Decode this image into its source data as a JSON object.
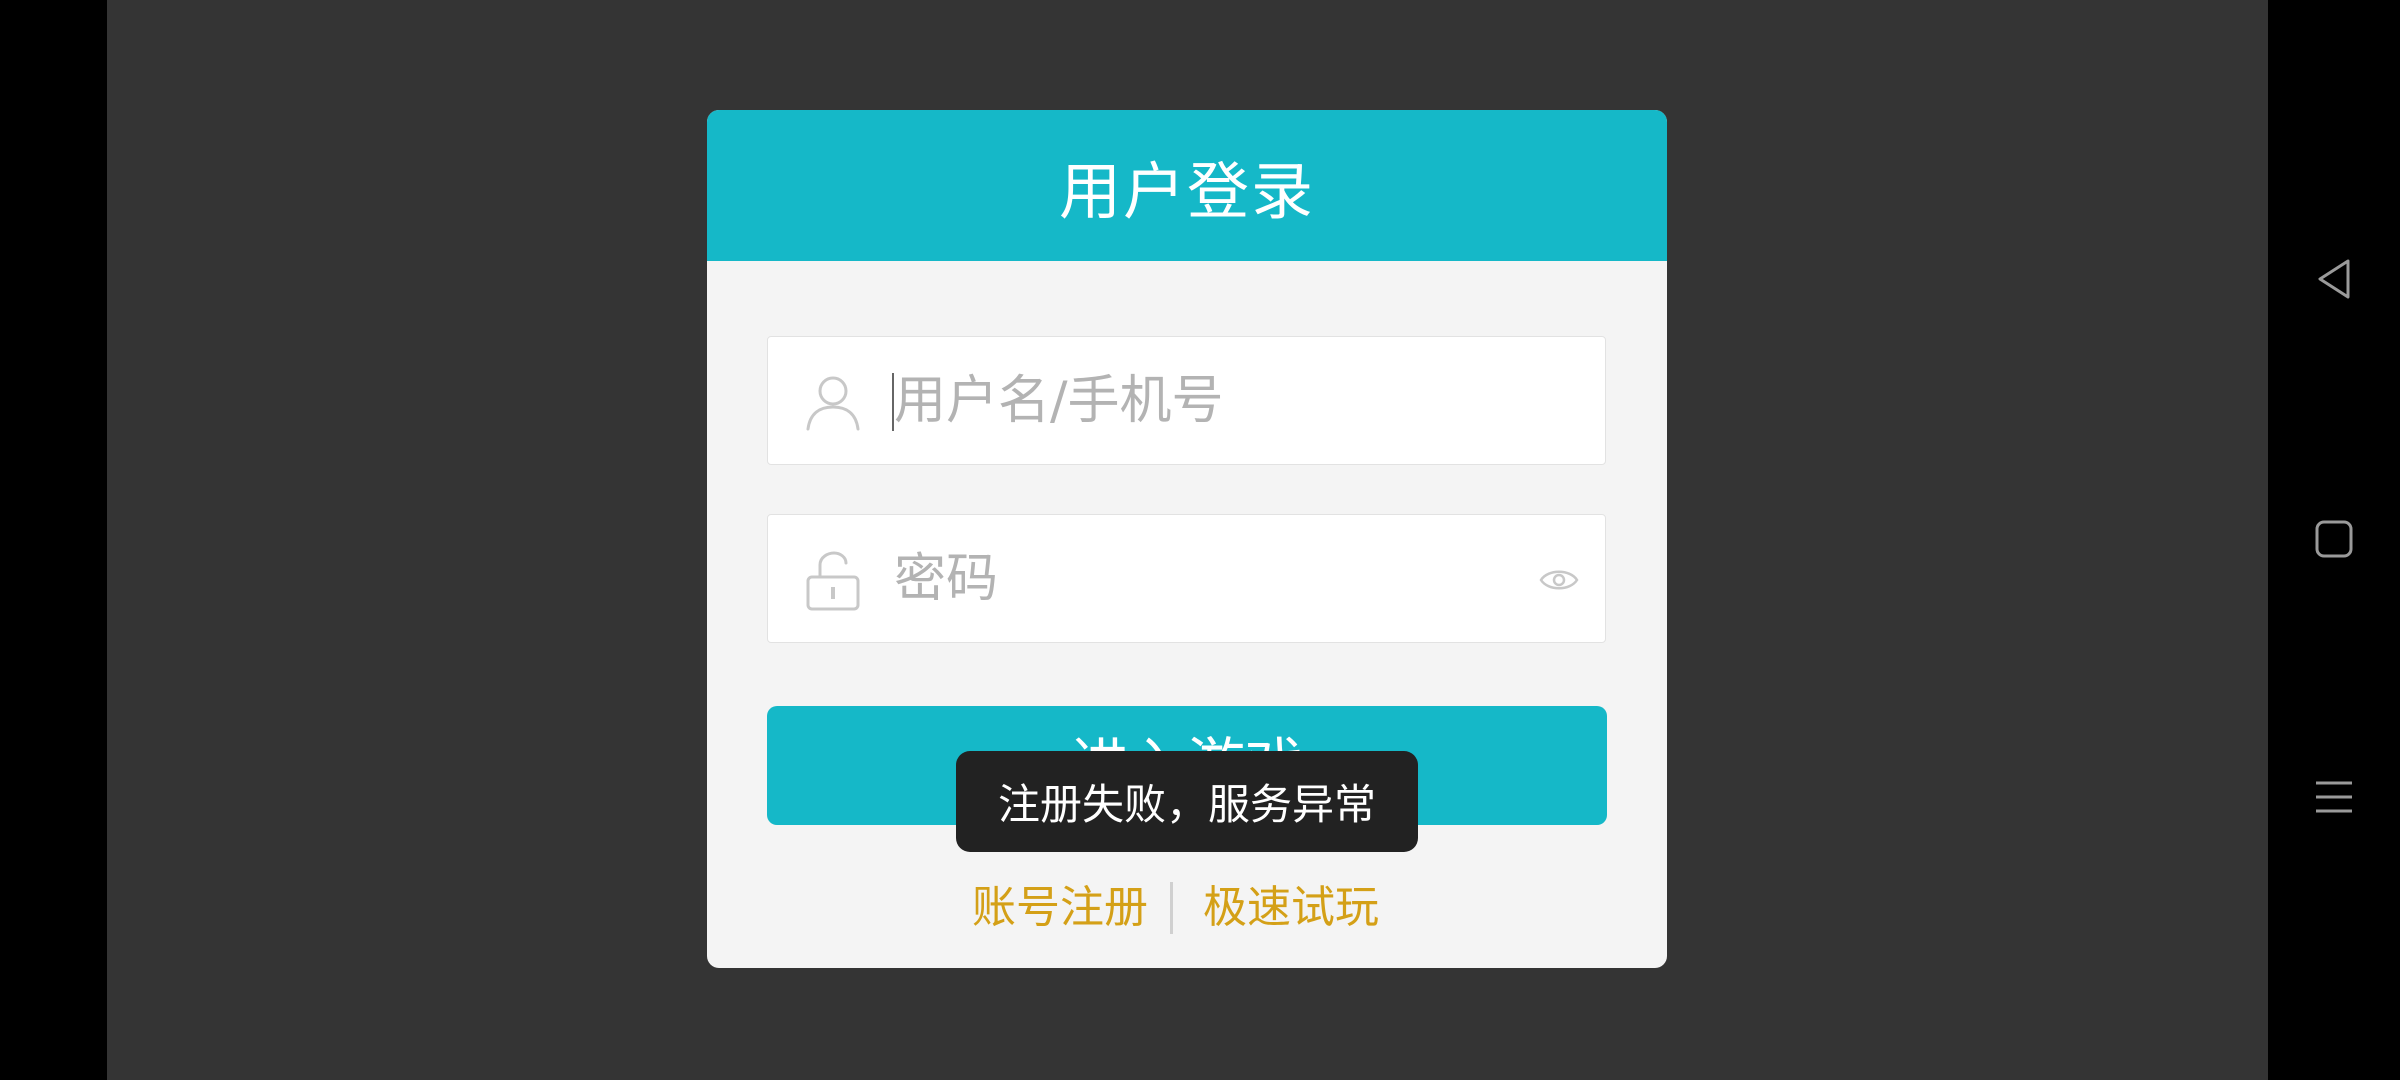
{
  "login_dialog": {
    "title": "用户登录",
    "username_field": {
      "placeholder": "用户名/手机号",
      "icon": "user-icon"
    },
    "password_field": {
      "placeholder": "密码",
      "icon": "unlock-icon",
      "toggle_icon": "eye-icon"
    },
    "enter_button_label": "进入游戏",
    "links": {
      "register": "账号注册",
      "quick_play": "极速试玩"
    }
  },
  "toast": {
    "message": "注册失败，服务异常"
  },
  "navigation_bar": {
    "buttons": [
      "back-icon",
      "home-square-icon",
      "menu-icon"
    ]
  },
  "colors": {
    "accent": "#15b8c8",
    "link": "#d4a017",
    "background": "#343434",
    "panel": "#f4f4f4",
    "toast_bg": "#222222"
  }
}
